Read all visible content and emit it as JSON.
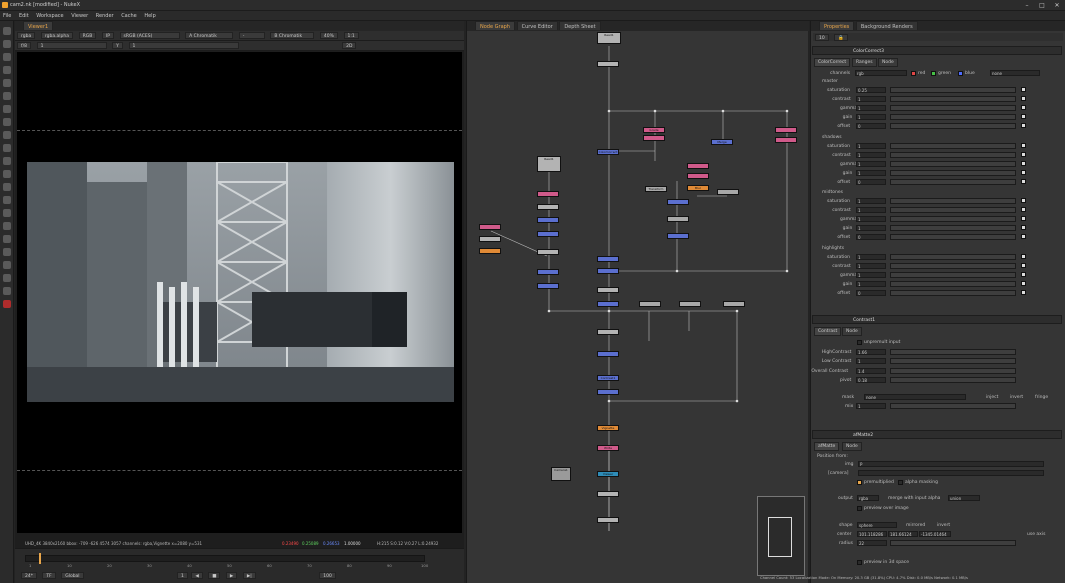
{
  "window": {
    "title": "cam2.nk [modified] - NukeX"
  },
  "menu": [
    "File",
    "Edit",
    "Workspace",
    "Viewer",
    "Render",
    "Cache",
    "Help"
  ],
  "viewer": {
    "tab": "Viewer1",
    "channels": "rgba",
    "alpha": "rgba.alpha",
    "colorspace_mode": "RGB",
    "ip": "IP",
    "lut": "sRGB (ACES)",
    "compare_a": "A  Chromatik",
    "compare_b": "B  Chromatik",
    "zoom": "40%",
    "ratio": "1:1",
    "frame_field": "f/8",
    "gain": "1",
    "gamma_label": "Y",
    "gamma": "1",
    "mode_2d": "2D",
    "status_left": "UHD_4K 3840x2160  bbox: -709 -626 4574 3057 channels: rgba,Vignette   x=2080 y=531",
    "status_r": "0.23490",
    "status_g": "0.25089",
    "status_b": "0.26653",
    "status_a": "1.00000",
    "status_hsv": "H:215 S:0.12 V:0.27  L:0.24932",
    "fps": "24*",
    "tf": "TF",
    "global": "Global",
    "frame_start": "1",
    "frame_end": "100",
    "current": "1",
    "ticks": [
      "1",
      "10",
      "20",
      "30",
      "40",
      "50",
      "60",
      "70",
      "80",
      "90",
      "100"
    ]
  },
  "nodegraph": {
    "tabs": [
      "Node Graph",
      "Curve Editor",
      "Depth Sheet"
    ],
    "nodes": [
      {
        "label": "Read1",
        "color": "#b3b3b3"
      },
      {
        "label": "Merge",
        "color": "#5b6fcf"
      },
      {
        "label": "Grade",
        "color": "#d05a8a"
      },
      {
        "label": "ColorCorrect",
        "color": "#5b6fcf"
      },
      {
        "label": "Blur",
        "color": "#e08a36"
      },
      {
        "label": "Transform",
        "color": "#a8a8a8"
      },
      {
        "label": "Contrast1",
        "color": "#5b6fcf"
      },
      {
        "label": "Vignette",
        "color": "#e08a36"
      },
      {
        "label": "Write",
        "color": "#d05a8a"
      },
      {
        "label": "Camera1",
        "color": "#9a9a9a"
      },
      {
        "label": "Viewer",
        "color": "#2e8cb8"
      }
    ]
  },
  "properties": {
    "tabs": [
      "Properties",
      "Background Renders"
    ],
    "panel1": {
      "name": "ColorCorrect3",
      "tabs": [
        "ColorCorrect",
        "Ranges",
        "Node"
      ],
      "channels_label": "channels",
      "channels_value": "rgb",
      "ch_r": "red",
      "ch_g": "green",
      "ch_b": "blue",
      "ch_extra": "none",
      "groups": [
        {
          "name": "master",
          "rows": [
            {
              "label": "saturation",
              "value": "0.25"
            },
            {
              "label": "contrast",
              "value": "1"
            },
            {
              "label": "gamma",
              "value": "1"
            },
            {
              "label": "gain",
              "value": "1"
            },
            {
              "label": "offset",
              "value": "0"
            }
          ]
        },
        {
          "name": "shadows",
          "rows": [
            {
              "label": "saturation",
              "value": "1"
            },
            {
              "label": "contrast",
              "value": "1"
            },
            {
              "label": "gamma",
              "value": "1"
            },
            {
              "label": "gain",
              "value": "1"
            },
            {
              "label": "offset",
              "value": "0"
            }
          ]
        },
        {
          "name": "midtones",
          "rows": [
            {
              "label": "saturation",
              "value": "1"
            },
            {
              "label": "contrast",
              "value": "1"
            },
            {
              "label": "gamma",
              "value": "1"
            },
            {
              "label": "gain",
              "value": "1"
            },
            {
              "label": "offset",
              "value": "0"
            }
          ]
        },
        {
          "name": "highlights",
          "rows": [
            {
              "label": "saturation",
              "value": "1"
            },
            {
              "label": "contrast",
              "value": "1"
            },
            {
              "label": "gamma",
              "value": "1"
            },
            {
              "label": "gain",
              "value": "1"
            },
            {
              "label": "offset",
              "value": "0"
            }
          ]
        }
      ]
    },
    "panel2": {
      "name": "Contrast1",
      "tabs": [
        "Contrast",
        "Node"
      ],
      "unpremult": "unpremult input",
      "rows": [
        {
          "label": "HighContrast",
          "value": "1.66"
        },
        {
          "label": "Low Contrast",
          "value": "1"
        },
        {
          "label": "Overall Contrast",
          "value": "1.4"
        },
        {
          "label": "pivot",
          "value": "0.18"
        }
      ],
      "mask_label": "mask",
      "mask_value": "none",
      "inject": "inject",
      "invert": "invert",
      "fringe": "fringe",
      "mix_label": "mix",
      "mix_value": "1"
    },
    "panel3": {
      "name": "afMatte2",
      "tabs": [
        "afMatte",
        "Node"
      ],
      "position_from": "Position from:",
      "img_label": "img",
      "img_value": "P",
      "camera_label": "[camera]",
      "premultiplied": "premultiplied",
      "alpha_masking": "alpha masking",
      "output_label": "output",
      "output_value": "rgba",
      "merge_label": "merge with input alpha",
      "merge_value": "union",
      "preview": "preview over image",
      "shape_label": "shape",
      "shape_value": "sphere",
      "mirrored": "mirrored",
      "invert": "invert",
      "center_label": "center",
      "center_x": "101.118286",
      "center_y": "181.66124",
      "center_z": "-1345.01464",
      "radius_label": "radius",
      "radius_value": "22",
      "use_axis": "use axis",
      "preview3d": "preview in 3d space"
    }
  },
  "statusbar": "Channel Count: 53  Localization Mode: On  Memory: 20.3 GB (31.8%)  CPU: 4.7%  Disk: 0.0 MB/s  Network: 0.1 MB/s",
  "colors": {
    "accent": "#e8a64b",
    "bg": "#353535",
    "panel": "#2d2d2d"
  }
}
